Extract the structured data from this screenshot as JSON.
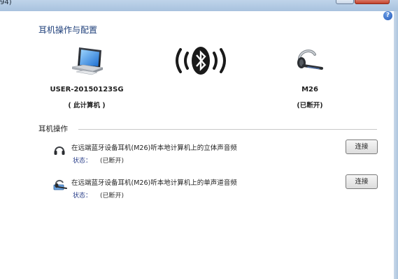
{
  "window": {
    "title_fragment": "94)"
  },
  "page": {
    "title": "耳机操作与配置"
  },
  "devices": {
    "computer": {
      "name": "USER-20150123SG",
      "sub": "( 此计算机 )",
      "icon": "computer-icon"
    },
    "headset": {
      "name": "M26",
      "sub": "(已断开)",
      "icon": "headset-icon"
    },
    "link_icon": "bluetooth-icon"
  },
  "section": {
    "label": "耳机操作"
  },
  "operations": [
    {
      "text": "在远端蓝牙设备耳机(M26)听本地计算机上的立体声音频",
      "status_label": "状态：",
      "status_value": "(已断开)",
      "button": "连接",
      "icon": "stereo-headphones-icon"
    },
    {
      "text": "在远端蓝牙设备耳机(M26)听本地计算机上的单声道音频",
      "status_label": "状态：",
      "status_value": "(已断开)",
      "button": "连接",
      "icon": "mono-headset-icon"
    }
  ],
  "help": {
    "label": "?"
  },
  "colors": {
    "title": "#1e3f7a",
    "status_label": "#2a3f8a",
    "bluetooth": "#1a1a1a"
  }
}
